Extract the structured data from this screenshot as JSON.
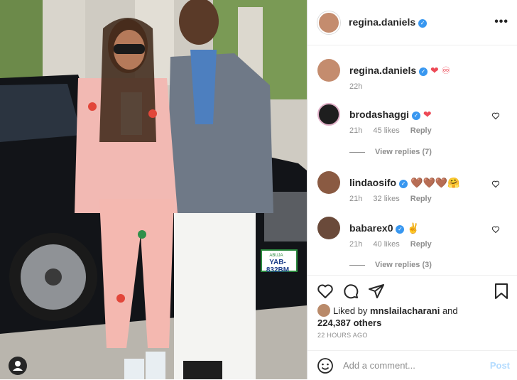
{
  "header": {
    "username": "regina.daniels",
    "more_label": "•••"
  },
  "caption": {
    "username": "regina.daniels",
    "emoji": "❤ ♾",
    "time": "22h"
  },
  "comments": [
    {
      "username": "brodashaggi",
      "text": "❤",
      "time": "21h",
      "likes": "45 likes",
      "reply": "Reply",
      "view_replies": "View replies (7)"
    },
    {
      "username": "lindaosifo",
      "text": "🤎🤎🤎🤗",
      "time": "21h",
      "likes": "32 likes",
      "reply": "Reply"
    },
    {
      "username": "babarex0",
      "text": "✌",
      "time": "21h",
      "likes": "40 likes",
      "reply": "Reply",
      "view_replies": "View replies (3)"
    }
  ],
  "likes": {
    "prefix": "Liked by ",
    "user": "mnslailacharani",
    "and": " and",
    "others": "224,387 others"
  },
  "timestamp": "22 HOURS AGO",
  "add_comment": {
    "placeholder": "Add a comment...",
    "post_label": "Post"
  },
  "photo": {
    "plate": "YAB-832BM",
    "plate_state": "ABUJA"
  },
  "colors": {
    "verified": "#3897f0",
    "like_red": "#ed4956",
    "post_disabled": "#b3dbff"
  }
}
